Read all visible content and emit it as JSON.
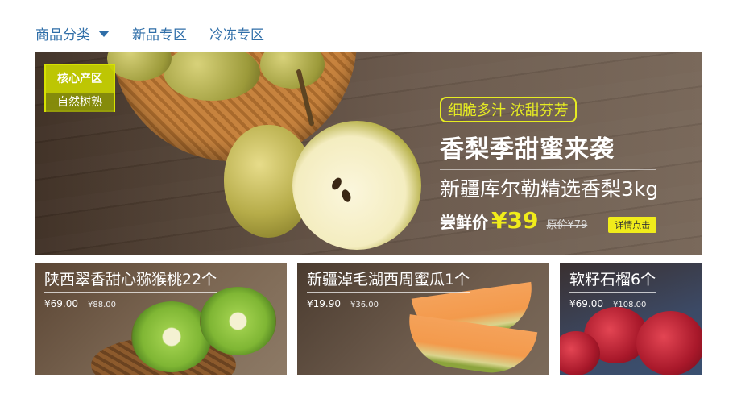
{
  "nav": {
    "category_label": "商品分类",
    "new_label": "新品专区",
    "frozen_label": "冷冻专区"
  },
  "hero": {
    "badge_top": "核心产区",
    "badge_bottom": "自然树熟",
    "tag": "细脆多汁 浓甜芬芳",
    "title": "香梨季甜蜜来袭",
    "subtitle": "新疆库尔勒精选香梨3kg",
    "price_label": "尝鲜价",
    "price": "¥39",
    "original_price": "原价¥79",
    "button": "详情点击"
  },
  "products": [
    {
      "title": "陕西翠香甜心猕猴桃22个",
      "price": "¥69.00",
      "original_price": "¥88.00"
    },
    {
      "title": "新疆淖毛湖西周蜜瓜1个",
      "price": "¥19.90",
      "original_price": "¥36.00"
    },
    {
      "title": "软籽石榴6个",
      "price": "¥69.00",
      "original_price": "¥108.00"
    }
  ],
  "colors": {
    "nav_text": "#2f6ea8",
    "accent_yellow": "#f0ec1b",
    "badge_green": "#d6e100"
  }
}
